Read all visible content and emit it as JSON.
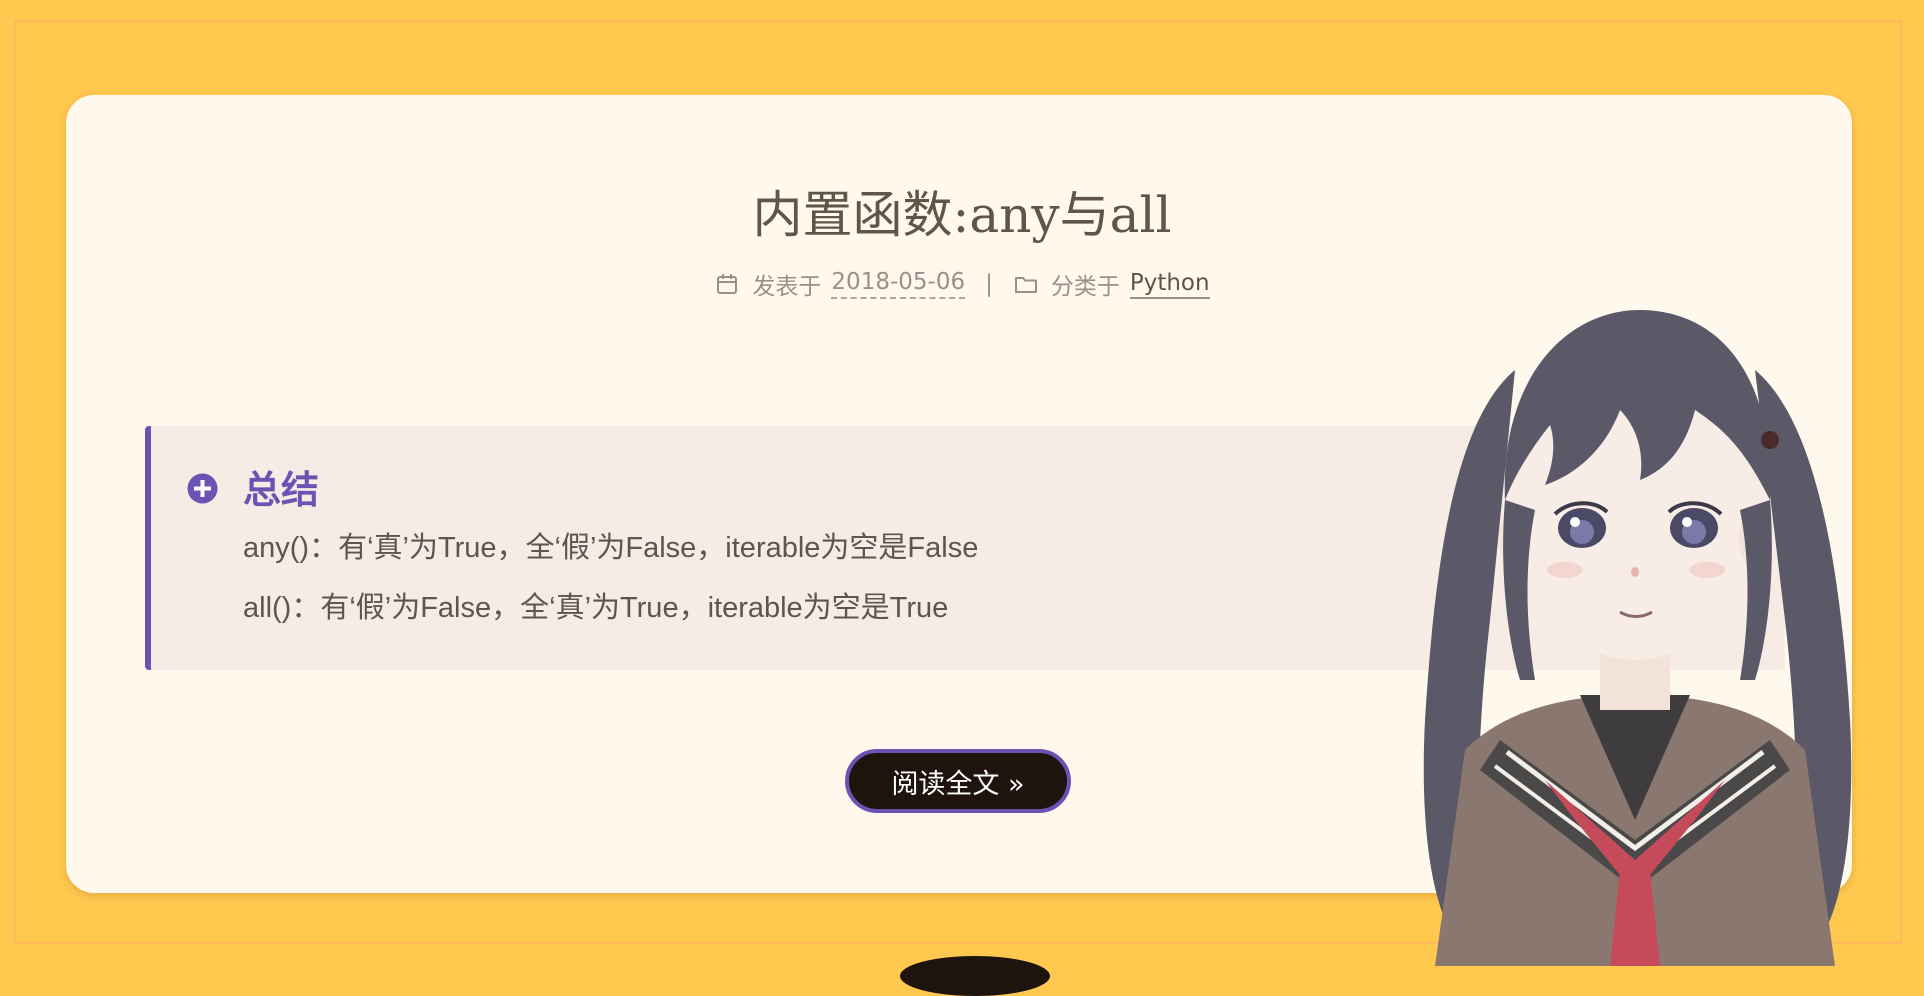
{
  "post": {
    "title": "内置函数:any与all",
    "meta": {
      "posted_label": "发表于",
      "date": "2018-05-06",
      "divider": "|",
      "category_label": "分类于",
      "category": "Python",
      "calendar_icon": "calendar-icon",
      "folder_icon": "folder-icon"
    },
    "note": {
      "icon": "plus-circle-icon",
      "heading": "总结",
      "lines": [
        "any()：有‘真’为True，全‘假’为False，iterable为空是False",
        "all()：有‘假’为False，全‘真’为True，iterable为空是True"
      ]
    },
    "read_more_label": "阅读全文 »"
  },
  "colors": {
    "page_background": "#ffc84f",
    "card_background": "#fff8ec",
    "accent": "#6b52b3",
    "text": "#5f554b",
    "muted_text": "#9a9088",
    "button_background": "#1e140d"
  },
  "mascot": {
    "name": "live2d-mascot"
  }
}
